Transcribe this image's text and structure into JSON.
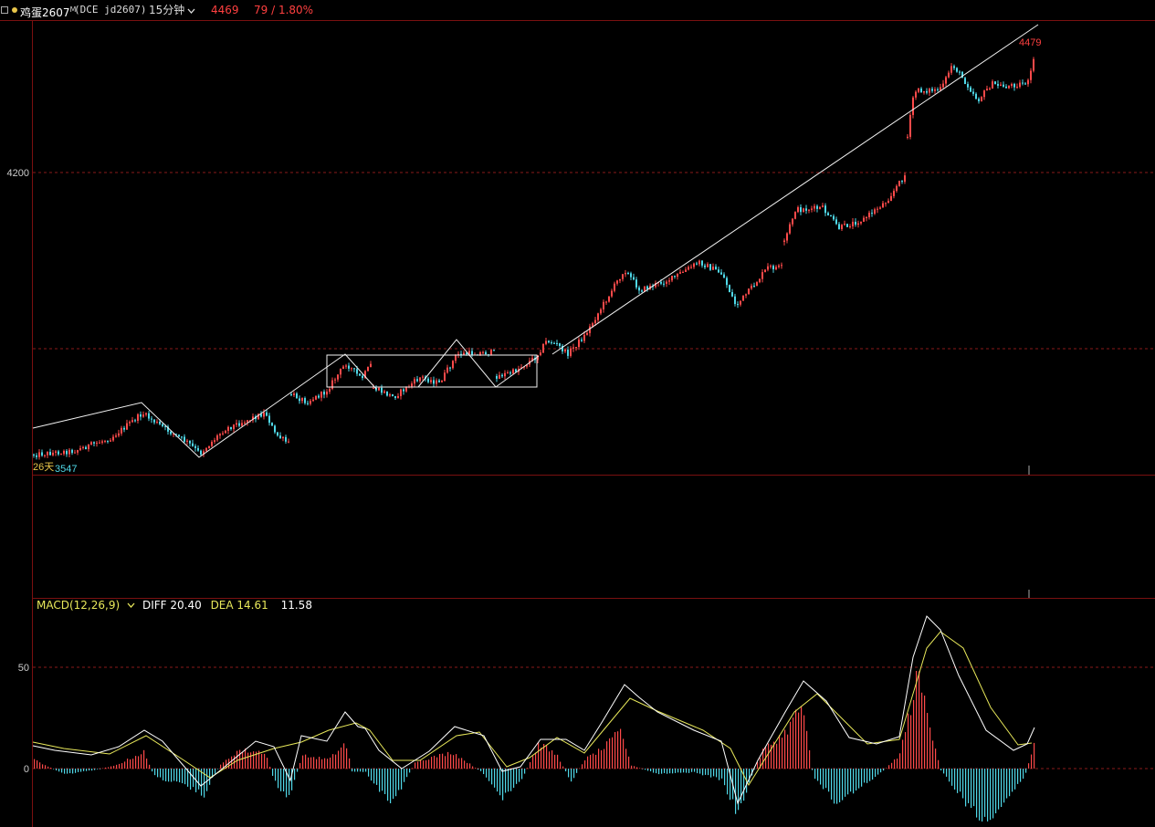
{
  "header": {
    "title": "鸡蛋2607",
    "title_mark": "M",
    "code": "(DCE jd2607)",
    "period": "15分钟",
    "last_price": "4469",
    "change": "79 / 1.80%"
  },
  "price_panel": {
    "y_label": "4200",
    "low_marker_days": "26天",
    "low_marker_price": "3547",
    "high_marker_price": "4479"
  },
  "macd": {
    "name": "MACD(12,26,9)",
    "diff_label": "DIFF 20.40",
    "dea_label": "DEA 14.61",
    "macd_value": "11.58",
    "axis_50": "50",
    "axis_0": "0"
  },
  "colors": {
    "up": "#ff4a4a",
    "down": "#4fd8e8",
    "grid": "#8a1a1a",
    "diff": "#ffffff",
    "dea": "#e8e85a"
  }
}
